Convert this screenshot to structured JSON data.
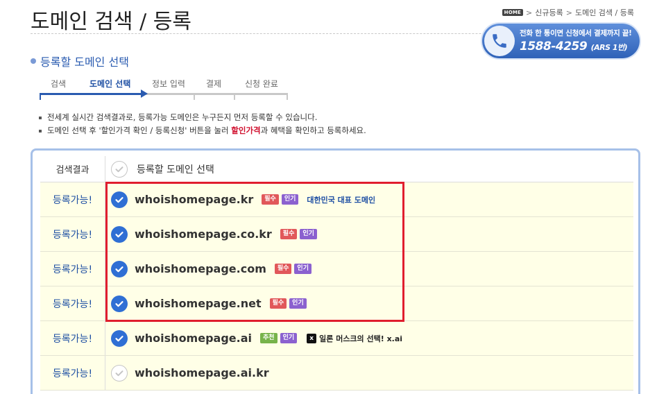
{
  "header": {
    "title": "도메인 검색 / 등록",
    "breadcrumb": {
      "home": "HOME",
      "items": [
        "신규등록",
        "도메인 검색 / 등록"
      ]
    }
  },
  "phone_banner": {
    "line1": "전화 한 통이면 신청에서 결제까지 끝!",
    "number": "1588-4259",
    "suffix": "(ARS 1번)"
  },
  "section": {
    "title": "등록할 도메인 선택"
  },
  "steps": [
    {
      "label": "검색",
      "active": false
    },
    {
      "label": "도메인 선택",
      "active": true
    },
    {
      "label": "정보 입력",
      "active": false
    },
    {
      "label": "결제",
      "active": false
    },
    {
      "label": "신청 완료",
      "active": false
    }
  ],
  "notice": {
    "line1": "전세계 실시간 검색결과로, 등록가능 도메인은 누구든지 먼저 등록할 수 있습니다.",
    "line2_pre": "도메인 선택 후 '할인가격 확인 / 등록신청' 버튼을 눌러 ",
    "line2_highlight": "할인가격",
    "line2_post": "과 혜택을 확인하고 등록하세요."
  },
  "table": {
    "headers": {
      "status": "검색결과",
      "domain": "등록할 도메인 선택"
    },
    "rows": [
      {
        "status": "등록가능!",
        "domain": "whoishomepage.kr",
        "checked": true,
        "badges": [
          "필수",
          "인기"
        ],
        "desc": "대한민국 대표 도메인"
      },
      {
        "status": "등록가능!",
        "domain": "whoishomepage.co.kr",
        "checked": true,
        "badges": [
          "필수",
          "인기"
        ],
        "desc": ""
      },
      {
        "status": "등록가능!",
        "domain": "whoishomepage.com",
        "checked": true,
        "badges": [
          "필수",
          "인기"
        ],
        "desc": ""
      },
      {
        "status": "등록가능!",
        "domain": "whoishomepage.net",
        "checked": true,
        "badges": [
          "필수",
          "인기"
        ],
        "desc": ""
      },
      {
        "status": "등록가능!",
        "domain": "whoishomepage.ai",
        "checked": true,
        "badges": [
          "추천",
          "인기"
        ],
        "desc": "",
        "promo": "일론 머스크의 선택! x.ai"
      },
      {
        "status": "등록가능!",
        "domain": "whoishomepage.ai.kr",
        "checked": false,
        "badges": [],
        "desc": ""
      }
    ]
  },
  "colors": {
    "accent_blue": "#2a5bb0",
    "check_blue": "#2f6fd4",
    "badge_pink": "#e1585a",
    "badge_purple": "#8b61cf",
    "badge_green": "#77b34a",
    "highlight_red": "#e01e2e",
    "row_bg": "#ffffe7"
  }
}
